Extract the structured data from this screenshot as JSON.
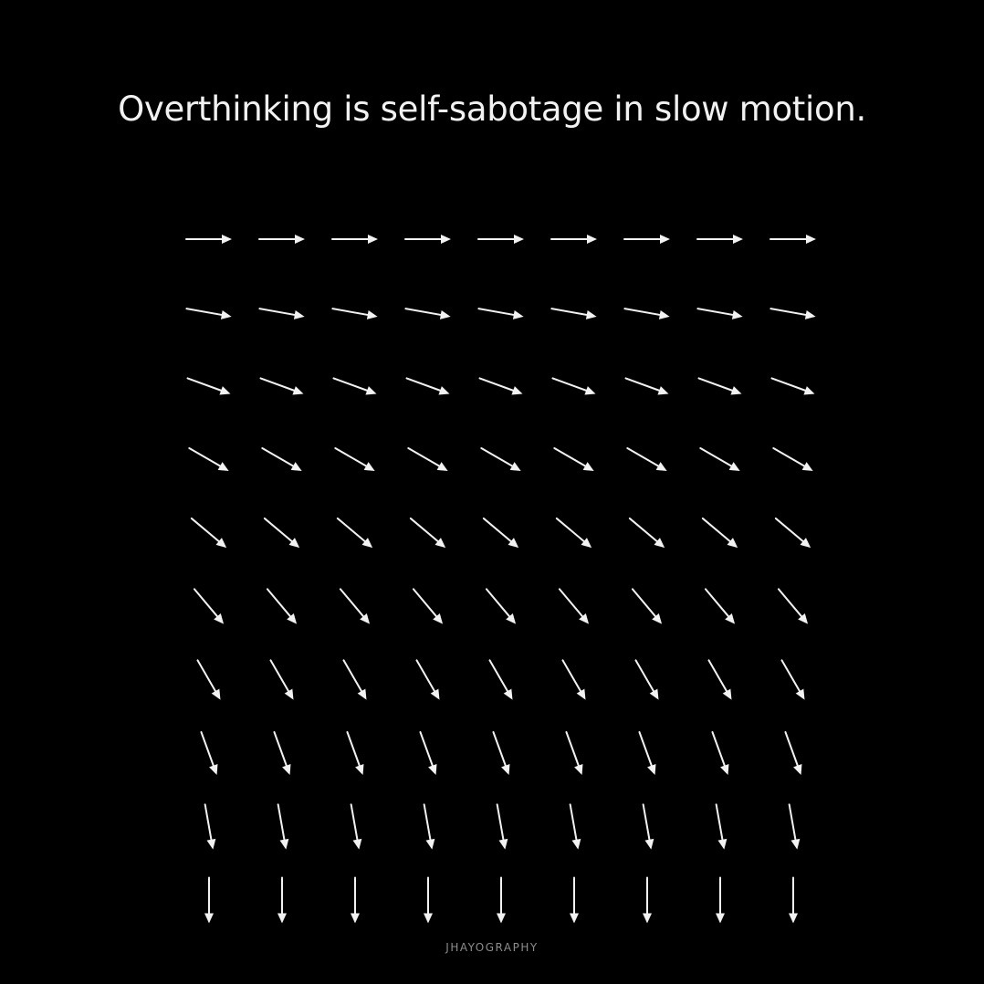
{
  "headline": "Overthinking is self-sabotage in slow motion.",
  "watermark": "JHAYOGRAPHY",
  "colors": {
    "background": "#000000",
    "foreground": "#f2f2f2",
    "watermark": "#8c8c8c"
  },
  "arrow_field": {
    "rows": 10,
    "columns": 9,
    "row_angles_deg": [
      0,
      10,
      20,
      30,
      40,
      50,
      60,
      70,
      80,
      90
    ]
  }
}
